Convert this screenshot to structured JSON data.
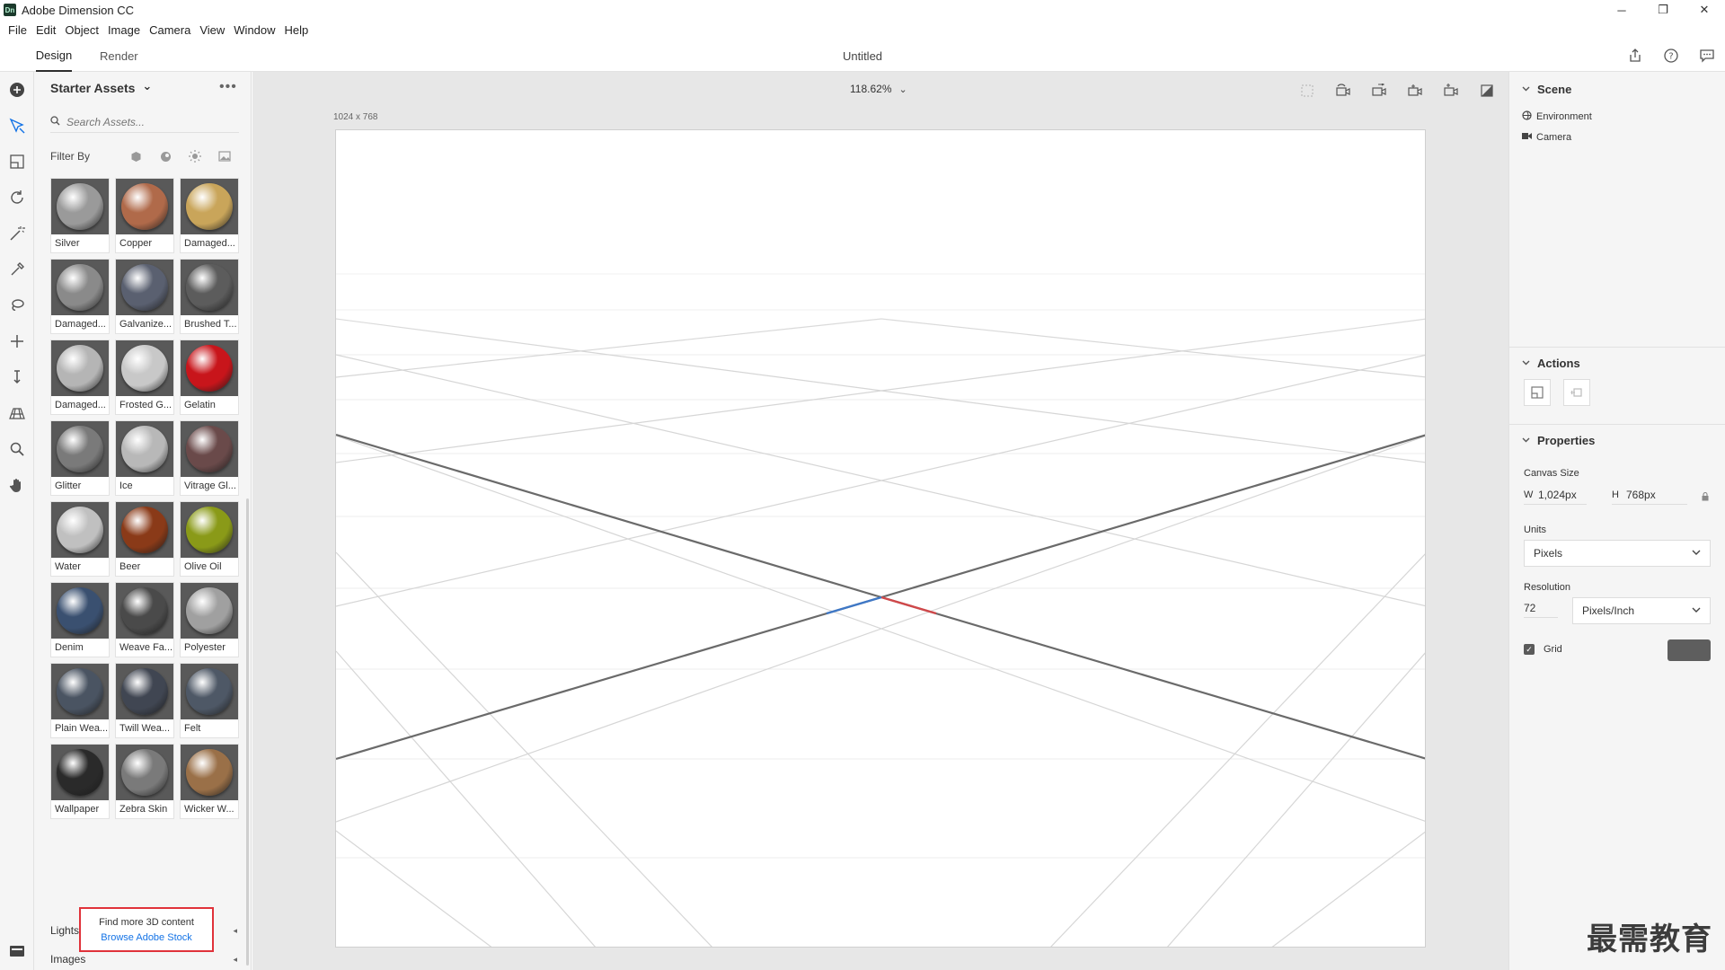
{
  "window": {
    "title": "Adobe Dimension CC",
    "logo_text": "Dn",
    "controls": {
      "minimize": "─",
      "restore": "❐",
      "close": "✕"
    }
  },
  "menu": [
    "File",
    "Edit",
    "Object",
    "Image",
    "Camera",
    "View",
    "Window",
    "Help"
  ],
  "tabs": {
    "design": "Design",
    "render": "Render",
    "document_title": "Untitled"
  },
  "toolbar_tools": [
    "add",
    "select",
    "frame",
    "orbit",
    "magic-wand",
    "sample",
    "lasso",
    "move",
    "height",
    "perspective",
    "zoom",
    "hand"
  ],
  "assets": {
    "title": "Starter Assets",
    "title_chevron": "⌄",
    "more": "•••",
    "search_placeholder": "Search Assets...",
    "filter_label": "Filter By",
    "materials": [
      {
        "label": "Silver",
        "color": "#9a9a9a"
      },
      {
        "label": "Copper",
        "color": "#b06a4a"
      },
      {
        "label": "Damaged...",
        "color": "#c9a55a"
      },
      {
        "label": "Damaged...",
        "color": "#8a8a8a"
      },
      {
        "label": "Galvanize...",
        "color": "#5a6070"
      },
      {
        "label": "Brushed T...",
        "color": "#5c5c5c"
      },
      {
        "label": "Damaged...",
        "color": "#b5b5b5"
      },
      {
        "label": "Frosted G...",
        "color": "#c8c8c8"
      },
      {
        "label": "Gelatin",
        "color": "#c8151b"
      },
      {
        "label": "Glitter",
        "color": "#7a7a7a"
      },
      {
        "label": "Ice",
        "color": "#b8b8b8"
      },
      {
        "label": "Vitrage Gl...",
        "color": "#6a4a4a"
      },
      {
        "label": "Water",
        "color": "#c0c0c0"
      },
      {
        "label": "Beer",
        "color": "#8a3a18"
      },
      {
        "label": "Olive Oil",
        "color": "#8a9a18"
      },
      {
        "label": "Denim",
        "color": "#3a5070"
      },
      {
        "label": "Weave Fa...",
        "color": "#4a4a4a"
      },
      {
        "label": "Polyester",
        "color": "#a0a0a0"
      },
      {
        "label": "Plain Wea...",
        "color": "#4a5462"
      },
      {
        "label": "Twill Wea...",
        "color": "#404652"
      },
      {
        "label": "Felt",
        "color": "#4e5866"
      },
      {
        "label": "Wallpaper",
        "color": "#2a2a2a"
      },
      {
        "label": "Zebra Skin",
        "color": "#7a7a7a"
      },
      {
        "label": "Wicker W...",
        "color": "#9a7048"
      }
    ],
    "lights_label": "Lights",
    "images_label": "Images",
    "section_caret": "◂",
    "stock_text": "Find more 3D content",
    "stock_link": "Browse Adobe Stock"
  },
  "canvas": {
    "zoom": "118.62%",
    "zoom_chevron": "⌄",
    "size_label": "1024 x 768"
  },
  "right_panel": {
    "scene_title": "Scene",
    "scene_items": [
      "Environment",
      "Camera"
    ],
    "actions_title": "Actions",
    "properties_title": "Properties",
    "canvas_size_label": "Canvas Size",
    "width_key": "W",
    "width_value": "1,024px",
    "height_key": "H",
    "height_value": "768px",
    "units_label": "Units",
    "units_value": "Pixels",
    "resolution_label": "Resolution",
    "resolution_value": "72",
    "resolution_unit": "Pixels/Inch",
    "grid_label": "Grid",
    "grid_checked": true,
    "grid_color": "#5e5e5e"
  },
  "watermark": "最需教育"
}
